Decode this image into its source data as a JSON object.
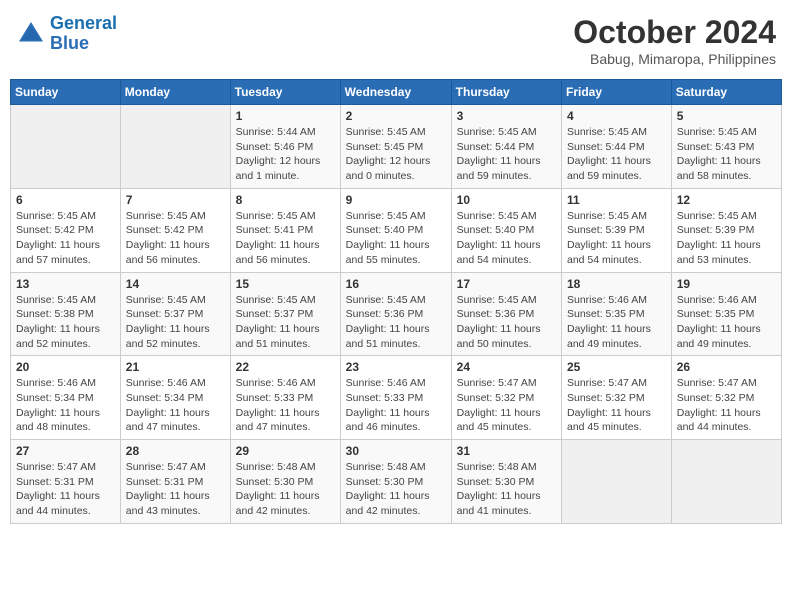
{
  "logo": {
    "text_general": "General",
    "text_blue": "Blue"
  },
  "header": {
    "title": "October 2024",
    "subtitle": "Babug, Mimaropa, Philippines"
  },
  "weekdays": [
    "Sunday",
    "Monday",
    "Tuesday",
    "Wednesday",
    "Thursday",
    "Friday",
    "Saturday"
  ],
  "weeks": [
    [
      {
        "day": "",
        "info": ""
      },
      {
        "day": "",
        "info": ""
      },
      {
        "day": "1",
        "info": "Sunrise: 5:44 AM\nSunset: 5:46 PM\nDaylight: 12 hours\nand 1 minute."
      },
      {
        "day": "2",
        "info": "Sunrise: 5:45 AM\nSunset: 5:45 PM\nDaylight: 12 hours\nand 0 minutes."
      },
      {
        "day": "3",
        "info": "Sunrise: 5:45 AM\nSunset: 5:44 PM\nDaylight: 11 hours\nand 59 minutes."
      },
      {
        "day": "4",
        "info": "Sunrise: 5:45 AM\nSunset: 5:44 PM\nDaylight: 11 hours\nand 59 minutes."
      },
      {
        "day": "5",
        "info": "Sunrise: 5:45 AM\nSunset: 5:43 PM\nDaylight: 11 hours\nand 58 minutes."
      }
    ],
    [
      {
        "day": "6",
        "info": "Sunrise: 5:45 AM\nSunset: 5:42 PM\nDaylight: 11 hours\nand 57 minutes."
      },
      {
        "day": "7",
        "info": "Sunrise: 5:45 AM\nSunset: 5:42 PM\nDaylight: 11 hours\nand 56 minutes."
      },
      {
        "day": "8",
        "info": "Sunrise: 5:45 AM\nSunset: 5:41 PM\nDaylight: 11 hours\nand 56 minutes."
      },
      {
        "day": "9",
        "info": "Sunrise: 5:45 AM\nSunset: 5:40 PM\nDaylight: 11 hours\nand 55 minutes."
      },
      {
        "day": "10",
        "info": "Sunrise: 5:45 AM\nSunset: 5:40 PM\nDaylight: 11 hours\nand 54 minutes."
      },
      {
        "day": "11",
        "info": "Sunrise: 5:45 AM\nSunset: 5:39 PM\nDaylight: 11 hours\nand 54 minutes."
      },
      {
        "day": "12",
        "info": "Sunrise: 5:45 AM\nSunset: 5:39 PM\nDaylight: 11 hours\nand 53 minutes."
      }
    ],
    [
      {
        "day": "13",
        "info": "Sunrise: 5:45 AM\nSunset: 5:38 PM\nDaylight: 11 hours\nand 52 minutes."
      },
      {
        "day": "14",
        "info": "Sunrise: 5:45 AM\nSunset: 5:37 PM\nDaylight: 11 hours\nand 52 minutes."
      },
      {
        "day": "15",
        "info": "Sunrise: 5:45 AM\nSunset: 5:37 PM\nDaylight: 11 hours\nand 51 minutes."
      },
      {
        "day": "16",
        "info": "Sunrise: 5:45 AM\nSunset: 5:36 PM\nDaylight: 11 hours\nand 51 minutes."
      },
      {
        "day": "17",
        "info": "Sunrise: 5:45 AM\nSunset: 5:36 PM\nDaylight: 11 hours\nand 50 minutes."
      },
      {
        "day": "18",
        "info": "Sunrise: 5:46 AM\nSunset: 5:35 PM\nDaylight: 11 hours\nand 49 minutes."
      },
      {
        "day": "19",
        "info": "Sunrise: 5:46 AM\nSunset: 5:35 PM\nDaylight: 11 hours\nand 49 minutes."
      }
    ],
    [
      {
        "day": "20",
        "info": "Sunrise: 5:46 AM\nSunset: 5:34 PM\nDaylight: 11 hours\nand 48 minutes."
      },
      {
        "day": "21",
        "info": "Sunrise: 5:46 AM\nSunset: 5:34 PM\nDaylight: 11 hours\nand 47 minutes."
      },
      {
        "day": "22",
        "info": "Sunrise: 5:46 AM\nSunset: 5:33 PM\nDaylight: 11 hours\nand 47 minutes."
      },
      {
        "day": "23",
        "info": "Sunrise: 5:46 AM\nSunset: 5:33 PM\nDaylight: 11 hours\nand 46 minutes."
      },
      {
        "day": "24",
        "info": "Sunrise: 5:47 AM\nSunset: 5:32 PM\nDaylight: 11 hours\nand 45 minutes."
      },
      {
        "day": "25",
        "info": "Sunrise: 5:47 AM\nSunset: 5:32 PM\nDaylight: 11 hours\nand 45 minutes."
      },
      {
        "day": "26",
        "info": "Sunrise: 5:47 AM\nSunset: 5:32 PM\nDaylight: 11 hours\nand 44 minutes."
      }
    ],
    [
      {
        "day": "27",
        "info": "Sunrise: 5:47 AM\nSunset: 5:31 PM\nDaylight: 11 hours\nand 44 minutes."
      },
      {
        "day": "28",
        "info": "Sunrise: 5:47 AM\nSunset: 5:31 PM\nDaylight: 11 hours\nand 43 minutes."
      },
      {
        "day": "29",
        "info": "Sunrise: 5:48 AM\nSunset: 5:30 PM\nDaylight: 11 hours\nand 42 minutes."
      },
      {
        "day": "30",
        "info": "Sunrise: 5:48 AM\nSunset: 5:30 PM\nDaylight: 11 hours\nand 42 minutes."
      },
      {
        "day": "31",
        "info": "Sunrise: 5:48 AM\nSunset: 5:30 PM\nDaylight: 11 hours\nand 41 minutes."
      },
      {
        "day": "",
        "info": ""
      },
      {
        "day": "",
        "info": ""
      }
    ]
  ]
}
